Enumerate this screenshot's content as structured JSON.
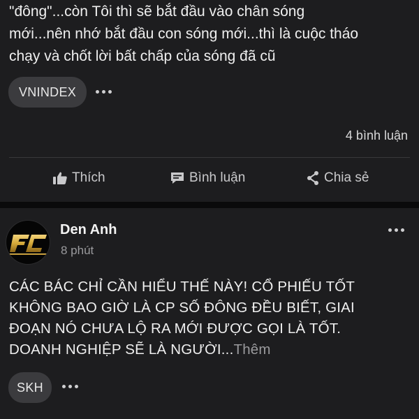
{
  "post1": {
    "text_lines": [
      "\"đông\"...còn Tôi thì sẽ bắt đầu vào chân sóng",
      "mới...nên nhớ bắt đầu con sóng mới...thì là cuộc tháo",
      "chạy và chốt lời bất chấp của sóng đã cũ"
    ],
    "tag": "VNINDEX",
    "comment_count": "4 bình luận",
    "actions": {
      "like": "Thích",
      "comment": "Bình luận",
      "share": "Chia sẻ"
    }
  },
  "post2": {
    "author": "Den Anh",
    "time": "8 phút",
    "text_lines": [
      "CÁC BÁC CHỈ CẦN HIỂU THẾ NÀY! CỔ PHIẾU TỐT",
      "KHÔNG BAO GIỜ LÀ CP SỐ ĐÔNG ĐỀU BIẾT, GIAI",
      "ĐOẠN NÓ CHƯA LỘ RA MỚI ĐƯỢC GỌI LÀ TỐT.",
      "DOANH NGHIỆP SẼ LÀ NGƯỜI..."
    ],
    "more_label": "Thêm",
    "tag": "SKH",
    "avatar_logo_icon": "fc-gold-logo"
  },
  "colors": {
    "card_bg": "#1d1d1f",
    "tag_bg": "#3b3b3e",
    "logo_gold": "#d4a93a"
  }
}
